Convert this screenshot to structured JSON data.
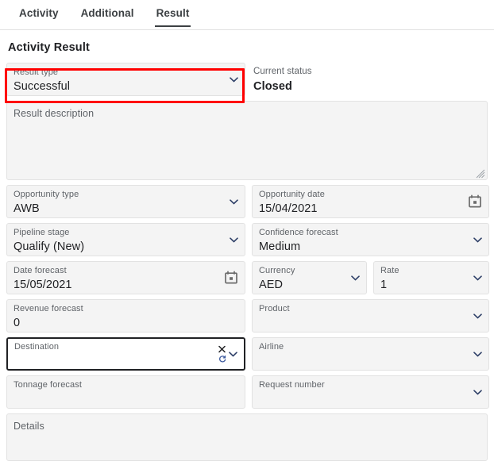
{
  "tabs": [
    {
      "label": "Activity",
      "active": false
    },
    {
      "label": "Additional",
      "active": false
    },
    {
      "label": "Result",
      "active": true
    }
  ],
  "section": {
    "title": "Activity Result"
  },
  "fields": {
    "result_type": {
      "label": "Result type",
      "value": "Successful",
      "icon": "chevron-down-icon"
    },
    "current_status": {
      "label": "Current status",
      "value": "Closed"
    },
    "result_description": {
      "label": "Result description",
      "value": ""
    },
    "opportunity_type": {
      "label": "Opportunity type",
      "value": "AWB",
      "icon": "chevron-down-icon"
    },
    "opportunity_date": {
      "label": "Opportunity date",
      "value": "15/04/2021",
      "icon": "calendar-icon"
    },
    "pipeline_stage": {
      "label": "Pipeline stage",
      "value": "Qualify (New)",
      "icon": "chevron-down-icon"
    },
    "confidence_forecast": {
      "label": "Confidence forecast",
      "value": "Medium",
      "icon": "chevron-down-icon"
    },
    "date_forecast": {
      "label": "Date forecast",
      "value": "15/05/2021",
      "icon": "calendar-icon"
    },
    "currency": {
      "label": "Currency",
      "value": "AED",
      "icon": "chevron-down-icon"
    },
    "rate": {
      "label": "Rate",
      "value": "1",
      "icon": "chevron-down-icon"
    },
    "revenue_forecast": {
      "label": "Revenue forecast",
      "value": "0"
    },
    "product": {
      "label": "Product",
      "value": "",
      "icon": "chevron-down-icon"
    },
    "destination": {
      "label": "Destination",
      "value": "",
      "icon": "chevron-down-icon",
      "focused": true
    },
    "airline": {
      "label": "Airline",
      "value": "",
      "icon": "chevron-down-icon"
    },
    "tonnage_forecast": {
      "label": "Tonnage forecast",
      "value": ""
    },
    "request_number": {
      "label": "Request number",
      "value": "",
      "icon": "chevron-down-icon"
    },
    "details": {
      "label": "Details",
      "value": ""
    }
  },
  "colors": {
    "annotation": "#ff0000",
    "field_background": "#f4f4f4",
    "field_border": "#e2e2e2",
    "label_text": "#5f6368",
    "value_text": "#202124",
    "tab_active_underline": "#3c4043"
  }
}
